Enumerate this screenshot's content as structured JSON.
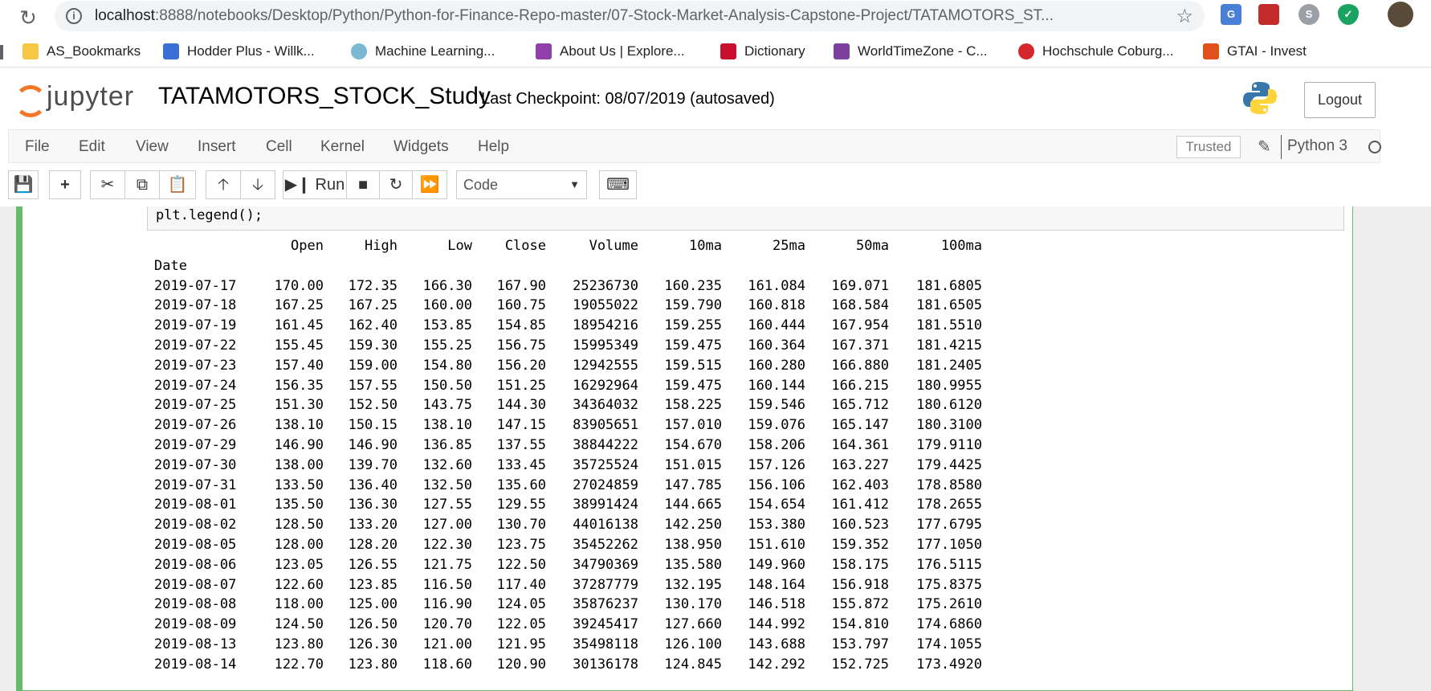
{
  "browser": {
    "url_host": "localhost",
    "url_path": ":8888/notebooks/Desktop/Python/Python-for-Finance-Repo-master/07-Stock-Market-Analysis-Capstone-Project/TATAMOTORS_ST...",
    "bookmarks": [
      {
        "label": "AS_Bookmarks",
        "color": "#f6c744"
      },
      {
        "label": "Hodder Plus - Willk...",
        "color": "#3a6fd8"
      },
      {
        "label": "Machine Learning...",
        "color": "#7ab8d6"
      },
      {
        "label": "About Us | Explore...",
        "color": "#8e3fa8"
      },
      {
        "label": "Dictionary",
        "color": "#c8102e"
      },
      {
        "label": "WorldTimeZone - C...",
        "color": "#7b3fa0"
      },
      {
        "label": "Hochschule Coburg...",
        "color": "#d4262c"
      },
      {
        "label": "GTAI - Invest",
        "color": "#e2511b"
      }
    ]
  },
  "jupyter": {
    "logo_text": "jupyter",
    "notebook_name": "TATAMOTORS_STOCK_Study",
    "checkpoint": "Last Checkpoint: 08/07/2019   (autosaved)",
    "logout": "Logout",
    "menu": [
      "File",
      "Edit",
      "View",
      "Insert",
      "Cell",
      "Kernel",
      "Widgets",
      "Help"
    ],
    "trusted": "Trusted",
    "kernel": "Python 3",
    "toolbar": {
      "run_label": "Run",
      "cell_type": "Code"
    }
  },
  "cell": {
    "code_tail": "plt.legend();",
    "index_name": "Date",
    "columns": [
      "Open",
      "High",
      "Low",
      "Close",
      "Volume",
      "10ma",
      "25ma",
      "50ma",
      "100ma"
    ],
    "rows": [
      [
        "2019-07-17",
        "170.00",
        "172.35",
        "166.30",
        "167.90",
        "25236730",
        "160.235",
        "161.084",
        "169.071",
        "181.6805"
      ],
      [
        "2019-07-18",
        "167.25",
        "167.25",
        "160.00",
        "160.75",
        "19055022",
        "159.790",
        "160.818",
        "168.584",
        "181.6505"
      ],
      [
        "2019-07-19",
        "161.45",
        "162.40",
        "153.85",
        "154.85",
        "18954216",
        "159.255",
        "160.444",
        "167.954",
        "181.5510"
      ],
      [
        "2019-07-22",
        "155.45",
        "159.30",
        "155.25",
        "156.75",
        "15995349",
        "159.475",
        "160.364",
        "167.371",
        "181.4215"
      ],
      [
        "2019-07-23",
        "157.40",
        "159.00",
        "154.80",
        "156.20",
        "12942555",
        "159.515",
        "160.280",
        "166.880",
        "181.2405"
      ],
      [
        "2019-07-24",
        "156.35",
        "157.55",
        "150.50",
        "151.25",
        "16292964",
        "159.475",
        "160.144",
        "166.215",
        "180.9955"
      ],
      [
        "2019-07-25",
        "151.30",
        "152.50",
        "143.75",
        "144.30",
        "34364032",
        "158.225",
        "159.546",
        "165.712",
        "180.6120"
      ],
      [
        "2019-07-26",
        "138.10",
        "150.15",
        "138.10",
        "147.15",
        "83905651",
        "157.010",
        "159.076",
        "165.147",
        "180.3100"
      ],
      [
        "2019-07-29",
        "146.90",
        "146.90",
        "136.85",
        "137.55",
        "38844222",
        "154.670",
        "158.206",
        "164.361",
        "179.9110"
      ],
      [
        "2019-07-30",
        "138.00",
        "139.70",
        "132.60",
        "133.45",
        "35725524",
        "151.015",
        "157.126",
        "163.227",
        "179.4425"
      ],
      [
        "2019-07-31",
        "133.50",
        "136.40",
        "132.50",
        "135.60",
        "27024859",
        "147.785",
        "156.106",
        "162.403",
        "178.8580"
      ],
      [
        "2019-08-01",
        "135.50",
        "136.30",
        "127.55",
        "129.55",
        "38991424",
        "144.665",
        "154.654",
        "161.412",
        "178.2655"
      ],
      [
        "2019-08-02",
        "128.50",
        "133.20",
        "127.00",
        "130.70",
        "44016138",
        "142.250",
        "153.380",
        "160.523",
        "177.6795"
      ],
      [
        "2019-08-05",
        "128.00",
        "128.20",
        "122.30",
        "123.75",
        "35452262",
        "138.950",
        "151.610",
        "159.352",
        "177.1050"
      ],
      [
        "2019-08-06",
        "123.05",
        "126.55",
        "121.75",
        "122.50",
        "34790369",
        "135.580",
        "149.960",
        "158.175",
        "176.5115"
      ],
      [
        "2019-08-07",
        "122.60",
        "123.85",
        "116.50",
        "117.40",
        "37287779",
        "132.195",
        "148.164",
        "156.918",
        "175.8375"
      ],
      [
        "2019-08-08",
        "118.00",
        "125.00",
        "116.90",
        "124.05",
        "35876237",
        "130.170",
        "146.518",
        "155.872",
        "175.2610"
      ],
      [
        "2019-08-09",
        "124.50",
        "126.50",
        "120.70",
        "122.05",
        "39245417",
        "127.660",
        "144.992",
        "154.810",
        "174.6860"
      ],
      [
        "2019-08-13",
        "123.80",
        "126.30",
        "121.00",
        "121.95",
        "35498118",
        "126.100",
        "143.688",
        "153.797",
        "174.1055"
      ],
      [
        "2019-08-14",
        "122.70",
        "123.80",
        "118.60",
        "120.90",
        "30136178",
        "124.845",
        "142.292",
        "152.725",
        "173.4920"
      ]
    ]
  },
  "colors": {
    "cell_selected": "#66bb6a",
    "jupyter_orange": "#f37726"
  }
}
